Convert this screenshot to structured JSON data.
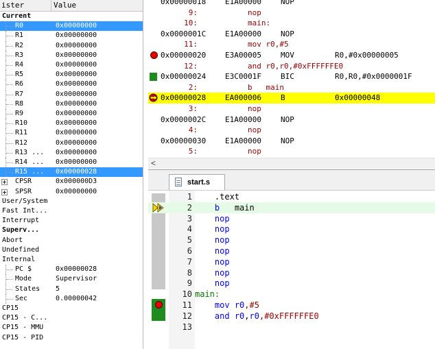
{
  "registers": {
    "header": {
      "col1": "ister",
      "col2": "Value"
    },
    "group_current": "Current",
    "current": [
      {
        "name": "R0",
        "value": "0x00000000",
        "selected": true
      },
      {
        "name": "R1",
        "value": "0x00000000"
      },
      {
        "name": "R2",
        "value": "0x00000000"
      },
      {
        "name": "R3",
        "value": "0x00000000"
      },
      {
        "name": "R4",
        "value": "0x00000000"
      },
      {
        "name": "R5",
        "value": "0x00000000"
      },
      {
        "name": "R6",
        "value": "0x00000000"
      },
      {
        "name": "R7",
        "value": "0x00000000"
      },
      {
        "name": "R8",
        "value": "0x00000000"
      },
      {
        "name": "R9",
        "value": "0x00000000"
      },
      {
        "name": "R10",
        "value": "0x00000000"
      },
      {
        "name": "R11",
        "value": "0x00000000"
      },
      {
        "name": "R12",
        "value": "0x00000000"
      },
      {
        "name": "R13 ...",
        "value": "0x00000000"
      },
      {
        "name": "R14 ...",
        "value": "0x00000000"
      },
      {
        "name": "R15 ...",
        "value": "0x00000028",
        "selected": true
      }
    ],
    "cpsr": {
      "name": "CPSR",
      "value": "0x000000D3"
    },
    "spsr": {
      "name": "SPSR",
      "value": "0x00000000"
    },
    "modes": [
      "User/System",
      "Fast Int...",
      "Interrupt",
      "Superv...",
      "Abort",
      "Undefined",
      "Internal"
    ],
    "internal": [
      {
        "name": "PC  $",
        "value": "0x00000028"
      },
      {
        "name": "Mode",
        "value": "Supervisor"
      },
      {
        "name": "States",
        "value": "5"
      },
      {
        "name": "Sec",
        "value": "0.00000042"
      }
    ],
    "cp15": [
      "CP15",
      "CP15 - C...",
      "CP15 - MMU",
      "CP15 - PID"
    ]
  },
  "disassembly": {
    "rows": [
      {
        "kind": "asm",
        "addr": "0x00000018",
        "hex": "E1A00000",
        "mn": "NOP",
        "ops": ""
      },
      {
        "kind": "src",
        "num": "9:",
        "text": "nop"
      },
      {
        "kind": "src",
        "num": "10:",
        "text": "main:"
      },
      {
        "kind": "asm",
        "addr": "0x0000001C",
        "hex": "E1A00000",
        "mn": "NOP",
        "ops": ""
      },
      {
        "kind": "src",
        "num": "11:",
        "text": "mov r0,#5"
      },
      {
        "kind": "asm",
        "addr": "0x00000020",
        "hex": "E3A00005",
        "mn": "MOV",
        "ops": "R0,#0x00000005",
        "marker": "breakpoint"
      },
      {
        "kind": "src",
        "num": "12:",
        "text": "and r0,r0,#0xFFFFFFE0"
      },
      {
        "kind": "asm",
        "addr": "0x00000024",
        "hex": "E3C0001F",
        "mn": "BIC",
        "ops": "R0,R0,#0x0000001F",
        "marker": "green"
      },
      {
        "kind": "src",
        "num": "2:",
        "text": "b   main"
      },
      {
        "kind": "asm",
        "addr": "0x00000028",
        "hex": "EA000006",
        "mn": "B",
        "ops": "0x00000048",
        "marker": "current",
        "current": true
      },
      {
        "kind": "src",
        "num": "3:",
        "text": "nop"
      },
      {
        "kind": "asm",
        "addr": "0x0000002C",
        "hex": "E1A00000",
        "mn": "NOP",
        "ops": ""
      },
      {
        "kind": "src",
        "num": "4:",
        "text": "nop"
      },
      {
        "kind": "asm",
        "addr": "0x00000030",
        "hex": "E1A00000",
        "mn": "NOP",
        "ops": ""
      },
      {
        "kind": "src",
        "num": "5:",
        "text": "nop"
      }
    ],
    "scroll_left": "<"
  },
  "editor": {
    "tab_label": "start.s",
    "lines": [
      {
        "n": "1",
        "parts": [
          {
            "t": "    .text",
            "c": ""
          }
        ]
      },
      {
        "n": "2",
        "parts": [
          {
            "t": "    ",
            "c": ""
          },
          {
            "t": "b",
            "c": "kw"
          },
          {
            "t": "   main",
            "c": ""
          }
        ],
        "current": true
      },
      {
        "n": "3",
        "parts": [
          {
            "t": "    ",
            "c": ""
          },
          {
            "t": "nop",
            "c": "kw"
          }
        ]
      },
      {
        "n": "4",
        "parts": [
          {
            "t": "    ",
            "c": ""
          },
          {
            "t": "nop",
            "c": "kw"
          }
        ]
      },
      {
        "n": "5",
        "parts": [
          {
            "t": "    ",
            "c": ""
          },
          {
            "t": "nop",
            "c": "kw"
          }
        ]
      },
      {
        "n": "6",
        "parts": [
          {
            "t": "    ",
            "c": ""
          },
          {
            "t": "nop",
            "c": "kw"
          }
        ]
      },
      {
        "n": "7",
        "parts": [
          {
            "t": "    ",
            "c": ""
          },
          {
            "t": "nop",
            "c": "kw"
          }
        ]
      },
      {
        "n": "8",
        "parts": [
          {
            "t": "    ",
            "c": ""
          },
          {
            "t": "nop",
            "c": "kw"
          }
        ]
      },
      {
        "n": "9",
        "parts": [
          {
            "t": "    ",
            "c": ""
          },
          {
            "t": "nop",
            "c": "kw"
          }
        ]
      },
      {
        "n": "10",
        "parts": [
          {
            "t": "main:",
            "c": "lab"
          }
        ]
      },
      {
        "n": "11",
        "parts": [
          {
            "t": "    ",
            "c": ""
          },
          {
            "t": "mov",
            "c": "kw"
          },
          {
            "t": " ",
            "c": ""
          },
          {
            "t": "r0",
            "c": "kw"
          },
          {
            "t": ",#5",
            "c": "num"
          }
        ]
      },
      {
        "n": "12",
        "parts": [
          {
            "t": "    ",
            "c": ""
          },
          {
            "t": "and",
            "c": "kw"
          },
          {
            "t": " ",
            "c": ""
          },
          {
            "t": "r0",
            "c": "kw"
          },
          {
            "t": ",",
            "c": ""
          },
          {
            "t": "r0",
            "c": "kw"
          },
          {
            "t": ",#0xFFFFFFE0",
            "c": "num"
          }
        ]
      },
      {
        "n": "13",
        "parts": []
      }
    ]
  },
  "icons": {
    "breakpoint": "breakpoint-icon",
    "current": "current-line-arrow-icon",
    "green": "executed-marker-icon",
    "tab": "document-icon"
  },
  "colors": {
    "selection": "#3399ff",
    "current_line": "#ffff00",
    "source_line": "#9b0000",
    "keyword": "#0000ff",
    "label": "#007800"
  }
}
